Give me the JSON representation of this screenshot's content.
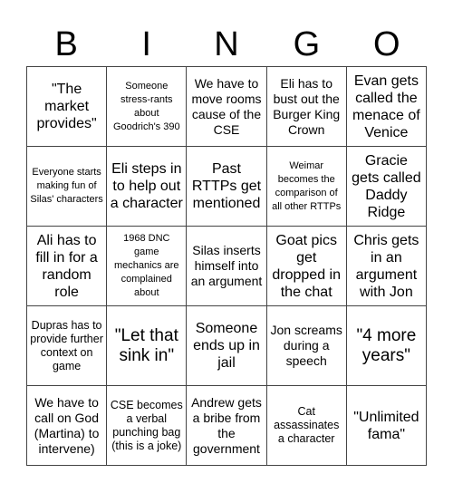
{
  "header": {
    "letters": [
      "B",
      "I",
      "N",
      "G",
      "O"
    ]
  },
  "board": {
    "cells": [
      "\"The market provides\"",
      "Someone stress-rants about Goodrich's 390",
      "We have to move rooms cause of the CSE",
      "Eli has to bust out the Burger King Crown",
      "Evan gets called the menace of Venice",
      "Everyone starts making fun of Silas' characters",
      "Eli steps in to help out a character",
      "Past RTTPs get mentioned",
      "Weimar becomes the comparison of all other RTTPs",
      "Gracie gets called Daddy Ridge",
      "Ali has to fill in for a random role",
      "1968 DNC game mechanics are complained about",
      "Silas inserts himself into an argument",
      "Goat pics get dropped in the chat",
      "Chris gets in an argument with Jon",
      "Dupras has to provide further context on game",
      "\"Let that sink in\"",
      "Someone ends up in jail",
      "Jon screams during a speech",
      "\"4 more years\"",
      "We have to call on God (Martina) to intervene)",
      "CSE becomes a verbal punching bag (this is a joke)",
      "Andrew gets a bribe from the government",
      "Cat assassinates a character",
      "\"Unlimited fama\""
    ]
  }
}
